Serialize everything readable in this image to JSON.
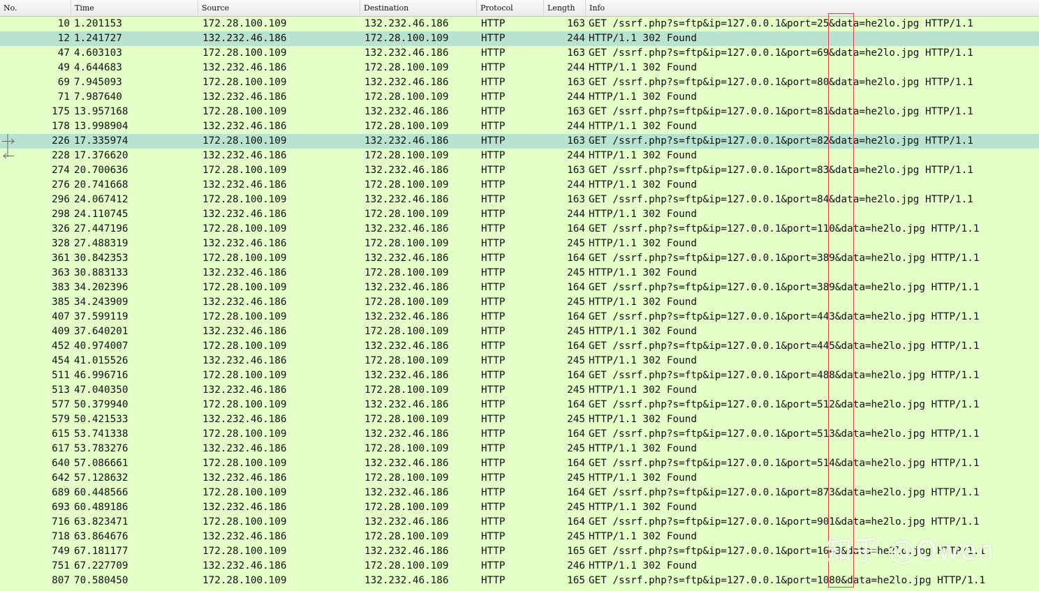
{
  "columns": [
    "No.",
    "Time",
    "Source",
    "Destination",
    "Protocol",
    "Length",
    "Info"
  ],
  "rows": [
    {
      "no": "10",
      "time": "1.201153",
      "src": "172.28.100.109",
      "dst": "132.232.46.186",
      "proto": "HTTP",
      "len": "163",
      "info": "GET /ssrf.php?s=ftp&ip=127.0.0.1&port=25&data=he2lo.jpg HTTP/1.1"
    },
    {
      "no": "12",
      "time": "1.241727",
      "src": "132.232.46.186",
      "dst": "172.28.100.109",
      "proto": "HTTP",
      "len": "244",
      "info": "HTTP/1.1 302 Found"
    },
    {
      "no": "47",
      "time": "4.603103",
      "src": "172.28.100.109",
      "dst": "132.232.46.186",
      "proto": "HTTP",
      "len": "163",
      "info": "GET /ssrf.php?s=ftp&ip=127.0.0.1&port=69&data=he2lo.jpg HTTP/1.1"
    },
    {
      "no": "49",
      "time": "4.644683",
      "src": "132.232.46.186",
      "dst": "172.28.100.109",
      "proto": "HTTP",
      "len": "244",
      "info": "HTTP/1.1 302 Found"
    },
    {
      "no": "69",
      "time": "7.945093",
      "src": "172.28.100.109",
      "dst": "132.232.46.186",
      "proto": "HTTP",
      "len": "163",
      "info": "GET /ssrf.php?s=ftp&ip=127.0.0.1&port=80&data=he2lo.jpg HTTP/1.1"
    },
    {
      "no": "71",
      "time": "7.987640",
      "src": "132.232.46.186",
      "dst": "172.28.100.109",
      "proto": "HTTP",
      "len": "244",
      "info": "HTTP/1.1 302 Found"
    },
    {
      "no": "175",
      "time": "13.957168",
      "src": "172.28.100.109",
      "dst": "132.232.46.186",
      "proto": "HTTP",
      "len": "163",
      "info": "GET /ssrf.php?s=ftp&ip=127.0.0.1&port=81&data=he2lo.jpg HTTP/1.1"
    },
    {
      "no": "178",
      "time": "13.998904",
      "src": "132.232.46.186",
      "dst": "172.28.100.109",
      "proto": "HTTP",
      "len": "244",
      "info": "HTTP/1.1 302 Found"
    },
    {
      "no": "226",
      "time": "17.335974",
      "src": "172.28.100.109",
      "dst": "132.232.46.186",
      "proto": "HTTP",
      "len": "163",
      "info": "GET /ssrf.php?s=ftp&ip=127.0.0.1&port=82&data=he2lo.jpg HTTP/1.1"
    },
    {
      "no": "228",
      "time": "17.376620",
      "src": "132.232.46.186",
      "dst": "172.28.100.109",
      "proto": "HTTP",
      "len": "244",
      "info": "HTTP/1.1 302 Found"
    },
    {
      "no": "274",
      "time": "20.700636",
      "src": "172.28.100.109",
      "dst": "132.232.46.186",
      "proto": "HTTP",
      "len": "163",
      "info": "GET /ssrf.php?s=ftp&ip=127.0.0.1&port=83&data=he2lo.jpg HTTP/1.1"
    },
    {
      "no": "276",
      "time": "20.741668",
      "src": "132.232.46.186",
      "dst": "172.28.100.109",
      "proto": "HTTP",
      "len": "244",
      "info": "HTTP/1.1 302 Found"
    },
    {
      "no": "296",
      "time": "24.067412",
      "src": "172.28.100.109",
      "dst": "132.232.46.186",
      "proto": "HTTP",
      "len": "163",
      "info": "GET /ssrf.php?s=ftp&ip=127.0.0.1&port=84&data=he2lo.jpg HTTP/1.1"
    },
    {
      "no": "298",
      "time": "24.110745",
      "src": "132.232.46.186",
      "dst": "172.28.100.109",
      "proto": "HTTP",
      "len": "244",
      "info": "HTTP/1.1 302 Found"
    },
    {
      "no": "326",
      "time": "27.447196",
      "src": "172.28.100.109",
      "dst": "132.232.46.186",
      "proto": "HTTP",
      "len": "164",
      "info": "GET /ssrf.php?s=ftp&ip=127.0.0.1&port=110&data=he2lo.jpg HTTP/1.1"
    },
    {
      "no": "328",
      "time": "27.488319",
      "src": "132.232.46.186",
      "dst": "172.28.100.109",
      "proto": "HTTP",
      "len": "245",
      "info": "HTTP/1.1 302 Found"
    },
    {
      "no": "361",
      "time": "30.842353",
      "src": "172.28.100.109",
      "dst": "132.232.46.186",
      "proto": "HTTP",
      "len": "164",
      "info": "GET /ssrf.php?s=ftp&ip=127.0.0.1&port=389&data=he2lo.jpg HTTP/1.1"
    },
    {
      "no": "363",
      "time": "30.883133",
      "src": "132.232.46.186",
      "dst": "172.28.100.109",
      "proto": "HTTP",
      "len": "245",
      "info": "HTTP/1.1 302 Found"
    },
    {
      "no": "383",
      "time": "34.202396",
      "src": "172.28.100.109",
      "dst": "132.232.46.186",
      "proto": "HTTP",
      "len": "164",
      "info": "GET /ssrf.php?s=ftp&ip=127.0.0.1&port=389&data=he2lo.jpg HTTP/1.1"
    },
    {
      "no": "385",
      "time": "34.243909",
      "src": "132.232.46.186",
      "dst": "172.28.100.109",
      "proto": "HTTP",
      "len": "245",
      "info": "HTTP/1.1 302 Found"
    },
    {
      "no": "407",
      "time": "37.599119",
      "src": "172.28.100.109",
      "dst": "132.232.46.186",
      "proto": "HTTP",
      "len": "164",
      "info": "GET /ssrf.php?s=ftp&ip=127.0.0.1&port=443&data=he2lo.jpg HTTP/1.1"
    },
    {
      "no": "409",
      "time": "37.640201",
      "src": "132.232.46.186",
      "dst": "172.28.100.109",
      "proto": "HTTP",
      "len": "245",
      "info": "HTTP/1.1 302 Found"
    },
    {
      "no": "452",
      "time": "40.974007",
      "src": "172.28.100.109",
      "dst": "132.232.46.186",
      "proto": "HTTP",
      "len": "164",
      "info": "GET /ssrf.php?s=ftp&ip=127.0.0.1&port=445&data=he2lo.jpg HTTP/1.1"
    },
    {
      "no": "454",
      "time": "41.015526",
      "src": "132.232.46.186",
      "dst": "172.28.100.109",
      "proto": "HTTP",
      "len": "245",
      "info": "HTTP/1.1 302 Found"
    },
    {
      "no": "511",
      "time": "46.996716",
      "src": "172.28.100.109",
      "dst": "132.232.46.186",
      "proto": "HTTP",
      "len": "164",
      "info": "GET /ssrf.php?s=ftp&ip=127.0.0.1&port=488&data=he2lo.jpg HTTP/1.1"
    },
    {
      "no": "513",
      "time": "47.040350",
      "src": "132.232.46.186",
      "dst": "172.28.100.109",
      "proto": "HTTP",
      "len": "245",
      "info": "HTTP/1.1 302 Found"
    },
    {
      "no": "577",
      "time": "50.379940",
      "src": "172.28.100.109",
      "dst": "132.232.46.186",
      "proto": "HTTP",
      "len": "164",
      "info": "GET /ssrf.php?s=ftp&ip=127.0.0.1&port=512&data=he2lo.jpg HTTP/1.1"
    },
    {
      "no": "579",
      "time": "50.421533",
      "src": "132.232.46.186",
      "dst": "172.28.100.109",
      "proto": "HTTP",
      "len": "245",
      "info": "HTTP/1.1 302 Found"
    },
    {
      "no": "615",
      "time": "53.741338",
      "src": "172.28.100.109",
      "dst": "132.232.46.186",
      "proto": "HTTP",
      "len": "164",
      "info": "GET /ssrf.php?s=ftp&ip=127.0.0.1&port=513&data=he2lo.jpg HTTP/1.1"
    },
    {
      "no": "617",
      "time": "53.783276",
      "src": "132.232.46.186",
      "dst": "172.28.100.109",
      "proto": "HTTP",
      "len": "245",
      "info": "HTTP/1.1 302 Found"
    },
    {
      "no": "640",
      "time": "57.086661",
      "src": "172.28.100.109",
      "dst": "132.232.46.186",
      "proto": "HTTP",
      "len": "164",
      "info": "GET /ssrf.php?s=ftp&ip=127.0.0.1&port=514&data=he2lo.jpg HTTP/1.1"
    },
    {
      "no": "642",
      "time": "57.128632",
      "src": "132.232.46.186",
      "dst": "172.28.100.109",
      "proto": "HTTP",
      "len": "245",
      "info": "HTTP/1.1 302 Found"
    },
    {
      "no": "689",
      "time": "60.448566",
      "src": "172.28.100.109",
      "dst": "132.232.46.186",
      "proto": "HTTP",
      "len": "164",
      "info": "GET /ssrf.php?s=ftp&ip=127.0.0.1&port=873&data=he2lo.jpg HTTP/1.1"
    },
    {
      "no": "693",
      "time": "60.489186",
      "src": "132.232.46.186",
      "dst": "172.28.100.109",
      "proto": "HTTP",
      "len": "245",
      "info": "HTTP/1.1 302 Found"
    },
    {
      "no": "716",
      "time": "63.823471",
      "src": "172.28.100.109",
      "dst": "132.232.46.186",
      "proto": "HTTP",
      "len": "164",
      "info": "GET /ssrf.php?s=ftp&ip=127.0.0.1&port=901&data=he2lo.jpg HTTP/1.1"
    },
    {
      "no": "718",
      "time": "63.864676",
      "src": "132.232.46.186",
      "dst": "172.28.100.109",
      "proto": "HTTP",
      "len": "245",
      "info": "HTTP/1.1 302 Found"
    },
    {
      "no": "749",
      "time": "67.181177",
      "src": "172.28.100.109",
      "dst": "132.232.46.186",
      "proto": "HTTP",
      "len": "165",
      "info": "GET /ssrf.php?s=ftp&ip=127.0.0.1&port=1043&data=he2lo.jpg HTTP/1.1"
    },
    {
      "no": "751",
      "time": "67.227709",
      "src": "132.232.46.186",
      "dst": "172.28.100.109",
      "proto": "HTTP",
      "len": "246",
      "info": "HTTP/1.1 302 Found"
    },
    {
      "no": "807",
      "time": "70.580450",
      "src": "172.28.100.109",
      "dst": "132.232.46.186",
      "proto": "HTTP",
      "len": "165",
      "info": "GET /ssrf.php?s=ftp&ip=127.0.0.1&port=1080&data=he2lo.jpg HTTP/1.1"
    }
  ],
  "selected_rows": [
    "12",
    "226"
  ],
  "related_markers": {
    "226": "request-arrow-icon",
    "228": "response-arrow-icon"
  },
  "watermark": "知乎 @Owen",
  "colors": {
    "row_background": "#e4ffc7",
    "selected_background": "#b8e3d0",
    "highlight_box": "#e34141",
    "header_background": "#f0f0f0"
  }
}
